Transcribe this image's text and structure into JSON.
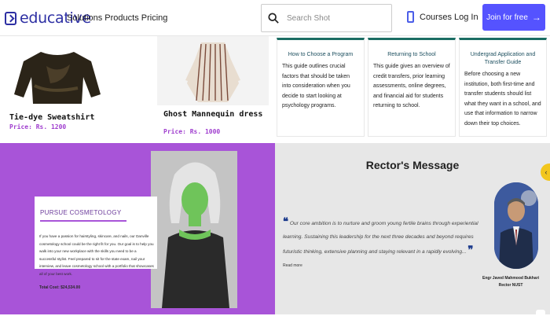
{
  "header": {
    "logo_text": "educative",
    "nav_links": "Solutions Products Pricing",
    "search_placeholder": "Search Shot",
    "courses_label": "Courses",
    "login_label": "Log In",
    "join_label": "Join for free"
  },
  "products": [
    {
      "name": "Tie-dye Sweatshirt",
      "price": "Price: Rs. 1200"
    },
    {
      "name": "Ghost Mannequin dress",
      "price": "Price: Rs. 1000"
    }
  ],
  "info_cards": [
    {
      "title": "How to Choose a Program",
      "body": "This guide outlines crucial factors that should be taken into consideration when you decide to start looking at psychology programs."
    },
    {
      "title": "Returning to School",
      "body": "This guide gives an overview of credit transfers, prior learning assessments, online degrees, and financial aid for students returning to school."
    },
    {
      "title": "Undergrad Application and Transfer Guide",
      "body": "Before choosing a new institution, both first-time and transfer students should list what they want in a school, and use that information to narrow down their top choices."
    }
  ],
  "cosmetology": {
    "title": "PURSUE COSMETOLOGY",
    "body": "If you have a passion for hairstyling, skincare, and nails, our Danville cosmetology school could be the right fit for you. Our goal is to help you walk into your new workplace with the skills you need to be a successful stylist. Feel prepared to sit for the state exam, nail your interview, and leave cosmetology school with a portfolio that showcases all of your best work.",
    "cost": "Total Cost: $24,534.00"
  },
  "rector": {
    "title": "Rector's Message",
    "quote": "Our core ambition is to nurture and groom young fertile brains through experiential learning. Sustaining this leadership for the next three decades and beyond requires futuristic thinking, extensive planning and staying relevant in a rapidly evolving...",
    "read_more": "Read more",
    "name": "Engr Javed Mahmood Bukhari",
    "role": "Rector NUST"
  },
  "colors": {
    "brand": "#2d2fa3",
    "join_button": "#5553ff",
    "cosmetology_bg": "#a854d8",
    "info_border": "#1b6d63",
    "price": "#a03fcf"
  }
}
